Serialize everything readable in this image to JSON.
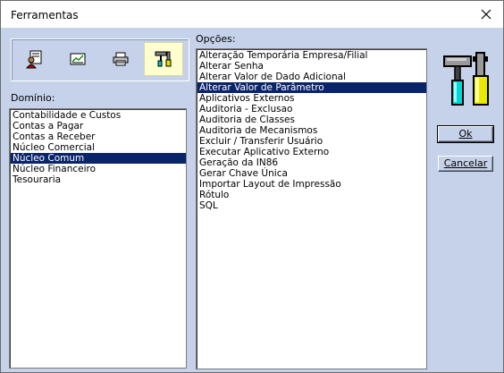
{
  "window": {
    "title": "Ferramentas",
    "close_label": "✕"
  },
  "toolbar": {
    "buttons": [
      {
        "name": "user-tool-icon"
      },
      {
        "name": "chart-tool-icon"
      },
      {
        "name": "printer-icon"
      },
      {
        "name": "tools-icon",
        "active": true
      }
    ]
  },
  "domain": {
    "label": "Domínio:",
    "items": [
      "Contabilidade e Custos",
      "Contas a Pagar",
      "Contas a Receber",
      "Núcleo Comercial",
      "Núcleo Comum",
      "Núcleo Financeiro",
      "Tesouraria"
    ],
    "selected": "Núcleo Comum"
  },
  "options": {
    "label": "Opções:",
    "items": [
      "Alteração Temporária Empresa/Filial",
      "Alterar Senha",
      "Alterar Valor de Dado Adicional",
      "Alterar Valor de Parâmetro",
      "Aplicativos Externos",
      "Auditoria - Exclusao",
      "Auditoria de Classes",
      "Auditoria de Mecanismos",
      "Excluir / Transferir Usuário",
      "Executar Aplicativo Externo",
      "Geração da IN86",
      "Gerar Chave Única",
      "Importar Layout de Impressão",
      "Rótulo",
      "SQL"
    ],
    "selected": "Alterar Valor de Parâmetro"
  },
  "actions": {
    "ok_label": "Ok",
    "cancel_label": "Cancelar"
  },
  "colors": {
    "selection": "#0a246a",
    "dialog_bg": "#c6d2ea"
  }
}
